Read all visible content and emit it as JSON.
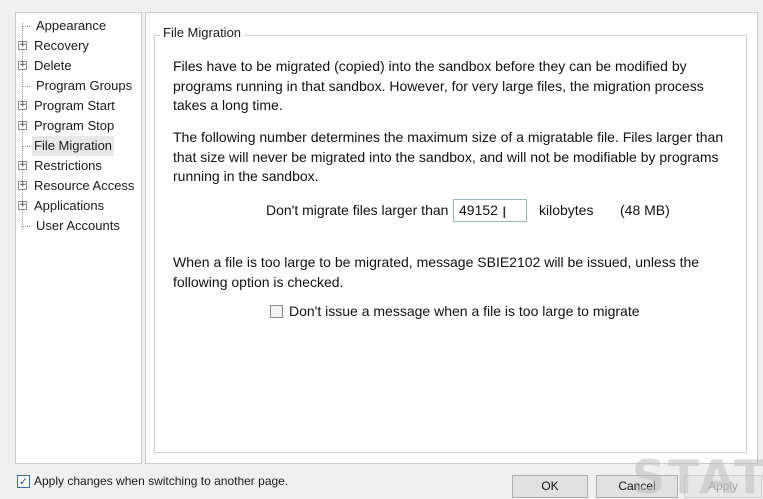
{
  "tree": {
    "items": [
      {
        "label": "Appearance",
        "expandable": false,
        "selected": false
      },
      {
        "label": "Recovery",
        "expandable": true,
        "selected": false
      },
      {
        "label": "Delete",
        "expandable": true,
        "selected": false
      },
      {
        "label": "Program Groups",
        "expandable": false,
        "selected": false
      },
      {
        "label": "Program Start",
        "expandable": true,
        "selected": false
      },
      {
        "label": "Program Stop",
        "expandable": true,
        "selected": false
      },
      {
        "label": "File Migration",
        "expandable": false,
        "selected": true
      },
      {
        "label": "Restrictions",
        "expandable": true,
        "selected": false
      },
      {
        "label": "Resource Access",
        "expandable": true,
        "selected": false
      },
      {
        "label": "Applications",
        "expandable": true,
        "selected": false
      },
      {
        "label": "User Accounts",
        "expandable": false,
        "selected": false
      }
    ],
    "expander_glyph": "⊞"
  },
  "page": {
    "group_title": "File Migration",
    "para1": "Files have to be migrated (copied) into the sandbox before they can be modified by programs running in that sandbox.  However, for very large files, the migration process takes a long time.",
    "para2": "The following number determines the maximum size of a migratable file.  Files larger than that size will never be migrated into the sandbox, and will not be modifiable by programs running in the sandbox.",
    "limit_label": "Don't migrate files larger than",
    "limit_value": "49152",
    "limit_unit": "kilobytes",
    "limit_mb": "(48 MB)",
    "para3": "When a file is too large to be migrated, message SBIE2102 will be issued, unless the following option is checked.",
    "no_message_label": "Don't issue a message when a file is too large to migrate",
    "no_message_checked": false
  },
  "footer": {
    "apply_on_switch_label": "Apply changes when switching to another page.",
    "apply_on_switch_checked": true,
    "ok_label": "OK",
    "cancel_label": "Cancel",
    "apply_label": "Apply"
  },
  "watermark": "STATI",
  "icons": {
    "tree_expander": "plus-box-icon",
    "text_cursor": "ibeam-cursor-icon",
    "checkmark": "checkmark-icon"
  }
}
